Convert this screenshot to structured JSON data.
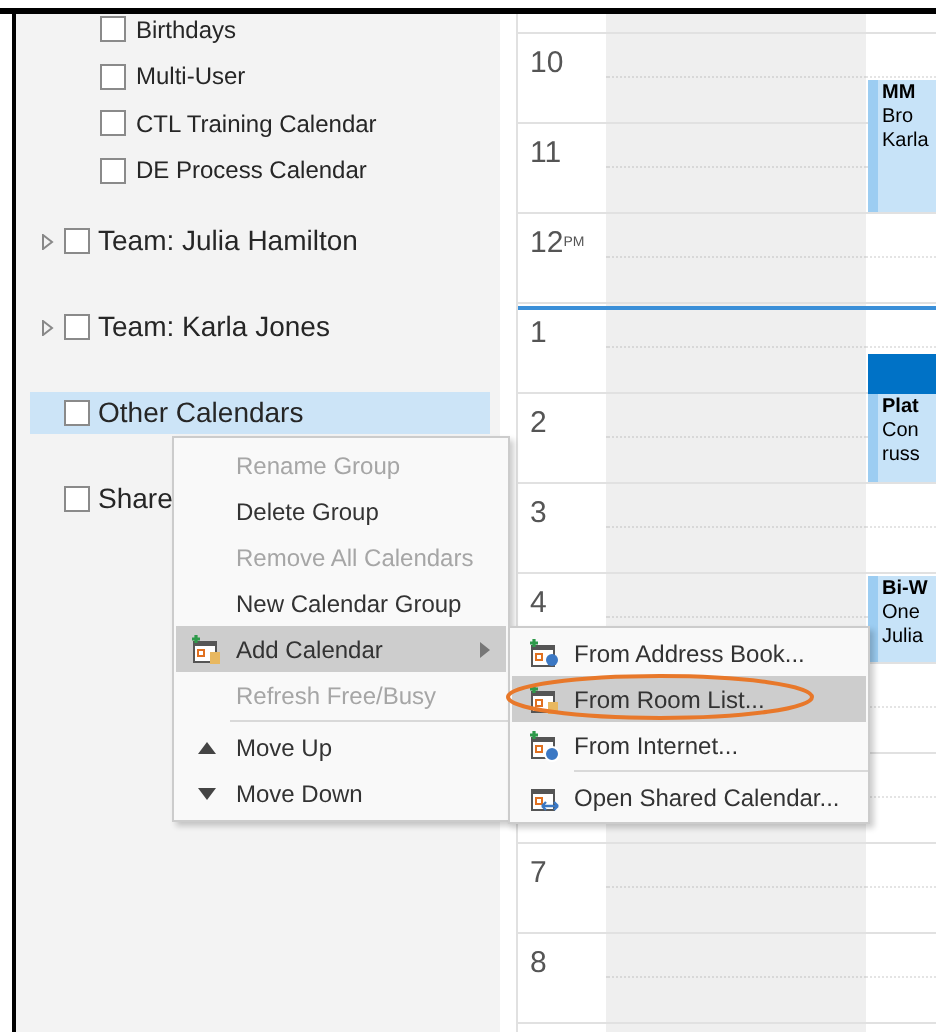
{
  "sidebar": {
    "calendars": [
      {
        "label": "Birthdays",
        "checked": false
      },
      {
        "label": "Multi-User",
        "checked": false
      },
      {
        "label": "CTL Training Calendar",
        "checked": false
      },
      {
        "label": "DE Process Calendar",
        "checked": false
      }
    ],
    "groups": [
      {
        "label": "Team: Julia Hamilton",
        "kind": "collapsible",
        "expanded": false,
        "checked": false,
        "selected": false
      },
      {
        "label": "Team: Karla Jones",
        "kind": "collapsible",
        "expanded": false,
        "checked": false,
        "selected": false
      },
      {
        "label": "Other Calendars",
        "kind": "plain",
        "checked": false,
        "selected": true
      },
      {
        "label": "Share",
        "kind": "plain",
        "checked": false,
        "selected": false
      }
    ]
  },
  "calendar": {
    "hours": [
      {
        "label": "10"
      },
      {
        "label": "11"
      },
      {
        "label": "12$^{PM}$"
      },
      {
        "label": "1"
      },
      {
        "label": "2"
      },
      {
        "label": "3"
      },
      {
        "label": "4"
      },
      {
        "label": "7"
      },
      {
        "label": "8"
      }
    ],
    "events": [
      {
        "lines": [
          "MM",
          "Bro",
          "Karla"
        ]
      },
      {
        "kind": "block"
      },
      {
        "lines": [
          "Plat",
          "Con",
          "russ"
        ]
      },
      {
        "lines": [
          "Bi-W",
          "One",
          "Julia"
        ]
      }
    ]
  },
  "context_menu": {
    "items": [
      {
        "kind": "command",
        "label": "Rename Group",
        "disabled": true,
        "selected": false
      },
      {
        "kind": "command",
        "label": "Delete Group",
        "disabled": false,
        "selected": false
      },
      {
        "kind": "command",
        "label": "Remove All Calendars",
        "disabled": true,
        "selected": false
      },
      {
        "kind": "command",
        "label": "New Calendar Group",
        "disabled": false,
        "selected": false
      },
      {
        "kind": "submenu",
        "label": "Add Calendar",
        "disabled": false,
        "selected": true
      },
      {
        "kind": "command",
        "label": "Refresh Free/Busy",
        "disabled": true,
        "selected": false
      },
      {
        "kind": "separator"
      },
      {
        "kind": "command",
        "label": "Move Up",
        "disabled": false,
        "selected": false
      },
      {
        "kind": "command",
        "label": "Move Down",
        "disabled": false,
        "selected": false
      }
    ]
  },
  "submenu": {
    "items": [
      {
        "kind": "command",
        "label": "From Address Book...",
        "selected": false
      },
      {
        "kind": "command",
        "label": "From Room List...",
        "selected": true
      },
      {
        "kind": "command",
        "label": "From Internet...",
        "selected": false
      },
      {
        "kind": "separator"
      },
      {
        "kind": "command",
        "label": "Open Shared Calendar...",
        "selected": false
      }
    ]
  }
}
